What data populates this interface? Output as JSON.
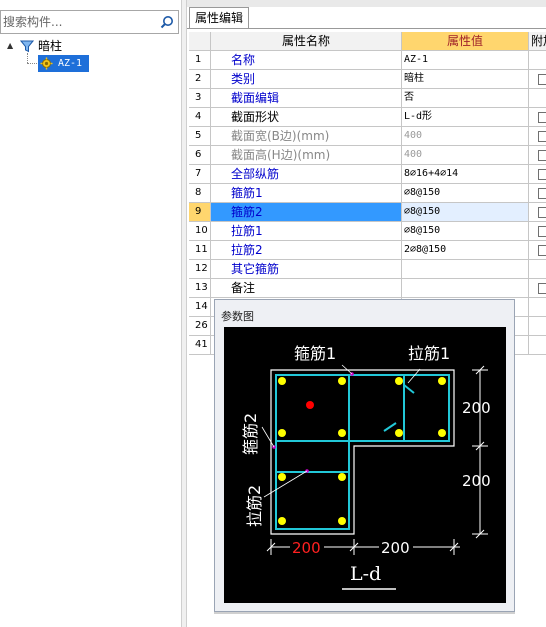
{
  "search": {
    "placeholder": "搜索构件..."
  },
  "tree": {
    "parent_label": "暗柱",
    "child_label": "AZ-1",
    "toggle_glyph": "▲"
  },
  "tab": {
    "label": "属性编辑"
  },
  "grid": {
    "headers": {
      "name": "属性名称",
      "value": "属性值",
      "extra": "附加"
    },
    "rows": [
      {
        "num": "1",
        "name": "名称",
        "value": "AZ-1",
        "style": "blue",
        "check": false
      },
      {
        "num": "2",
        "name": "类别",
        "value": "暗柱",
        "style": "blue",
        "check": true
      },
      {
        "num": "3",
        "name": "截面编辑",
        "value": "否",
        "style": "blue",
        "check": false
      },
      {
        "num": "4",
        "name": "截面形状",
        "value": "L-d形",
        "style": "black",
        "check": true
      },
      {
        "num": "5",
        "name": "截面宽(B边)(mm)",
        "value": "400",
        "style": "gray",
        "check": true
      },
      {
        "num": "6",
        "name": "截面高(H边)(mm)",
        "value": "400",
        "style": "gray",
        "check": true
      },
      {
        "num": "7",
        "name": "全部纵筋",
        "value": "8⌀16+4⌀14",
        "style": "blue",
        "check": true
      },
      {
        "num": "8",
        "name": "箍筋1",
        "value": "⌀8@150",
        "style": "blue",
        "check": true
      },
      {
        "num": "9",
        "name": "箍筋2",
        "value": "⌀8@150",
        "style": "blue",
        "check": true,
        "selected": true
      },
      {
        "num": "10",
        "name": "拉筋1",
        "value": "⌀8@150",
        "style": "blue",
        "check": true
      },
      {
        "num": "11",
        "name": "拉筋2",
        "value": "2⌀8@150",
        "style": "blue",
        "check": true
      },
      {
        "num": "12",
        "name": "其它箍筋",
        "value": "",
        "style": "blue",
        "check": false
      },
      {
        "num": "13",
        "name": "备注",
        "value": "",
        "style": "black",
        "check": true
      },
      {
        "num": "14",
        "name": "",
        "value": "",
        "style": "black",
        "check": false
      },
      {
        "num": "26",
        "name": "",
        "value": "",
        "style": "black",
        "check": false
      },
      {
        "num": "41",
        "name": "",
        "value": "",
        "style": "black",
        "check": false
      }
    ]
  },
  "popup": {
    "title": "参数图",
    "labels": {
      "stirrup1": "箍筋1",
      "tie1": "拉筋1",
      "stirrup2": "箍筋2",
      "tie2": "拉筋2",
      "dim_right_top": "200",
      "dim_right_bottom": "200",
      "dim_bottom_left": "200",
      "dim_bottom_right": "200",
      "shape": "L-d"
    },
    "colors": {
      "bg": "#000000",
      "outline": "#ffffff",
      "stirrup": "#22c8d8",
      "bar": "#ffff00",
      "center": "#ff0000",
      "hook": "#cc00cc",
      "dim_highlight": "#ff2020"
    }
  }
}
